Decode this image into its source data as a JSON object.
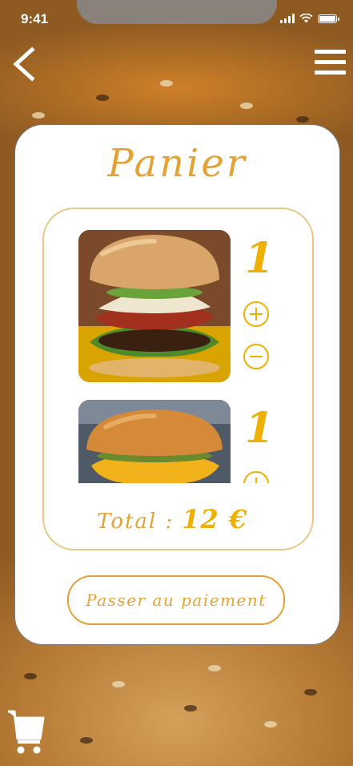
{
  "status_bar": {
    "time": "9:41"
  },
  "nav": {
    "back_icon": "chevron-left-icon",
    "menu_icon": "hamburger-menu-icon"
  },
  "cart": {
    "title": "Panier",
    "items": [
      {
        "image": "bacon-burger-photo",
        "quantity": "1"
      },
      {
        "image": "cheeseburger-photo",
        "quantity": "1"
      }
    ],
    "total_label": "Total :",
    "total_value": "12 €",
    "pay_button": "Passer au paiement"
  },
  "bottom": {
    "cart_icon": "shopping-cart-icon"
  },
  "colors": {
    "accent": "#e4a234",
    "quantity": "#f0b000",
    "inner_border": "#e9c68a"
  }
}
